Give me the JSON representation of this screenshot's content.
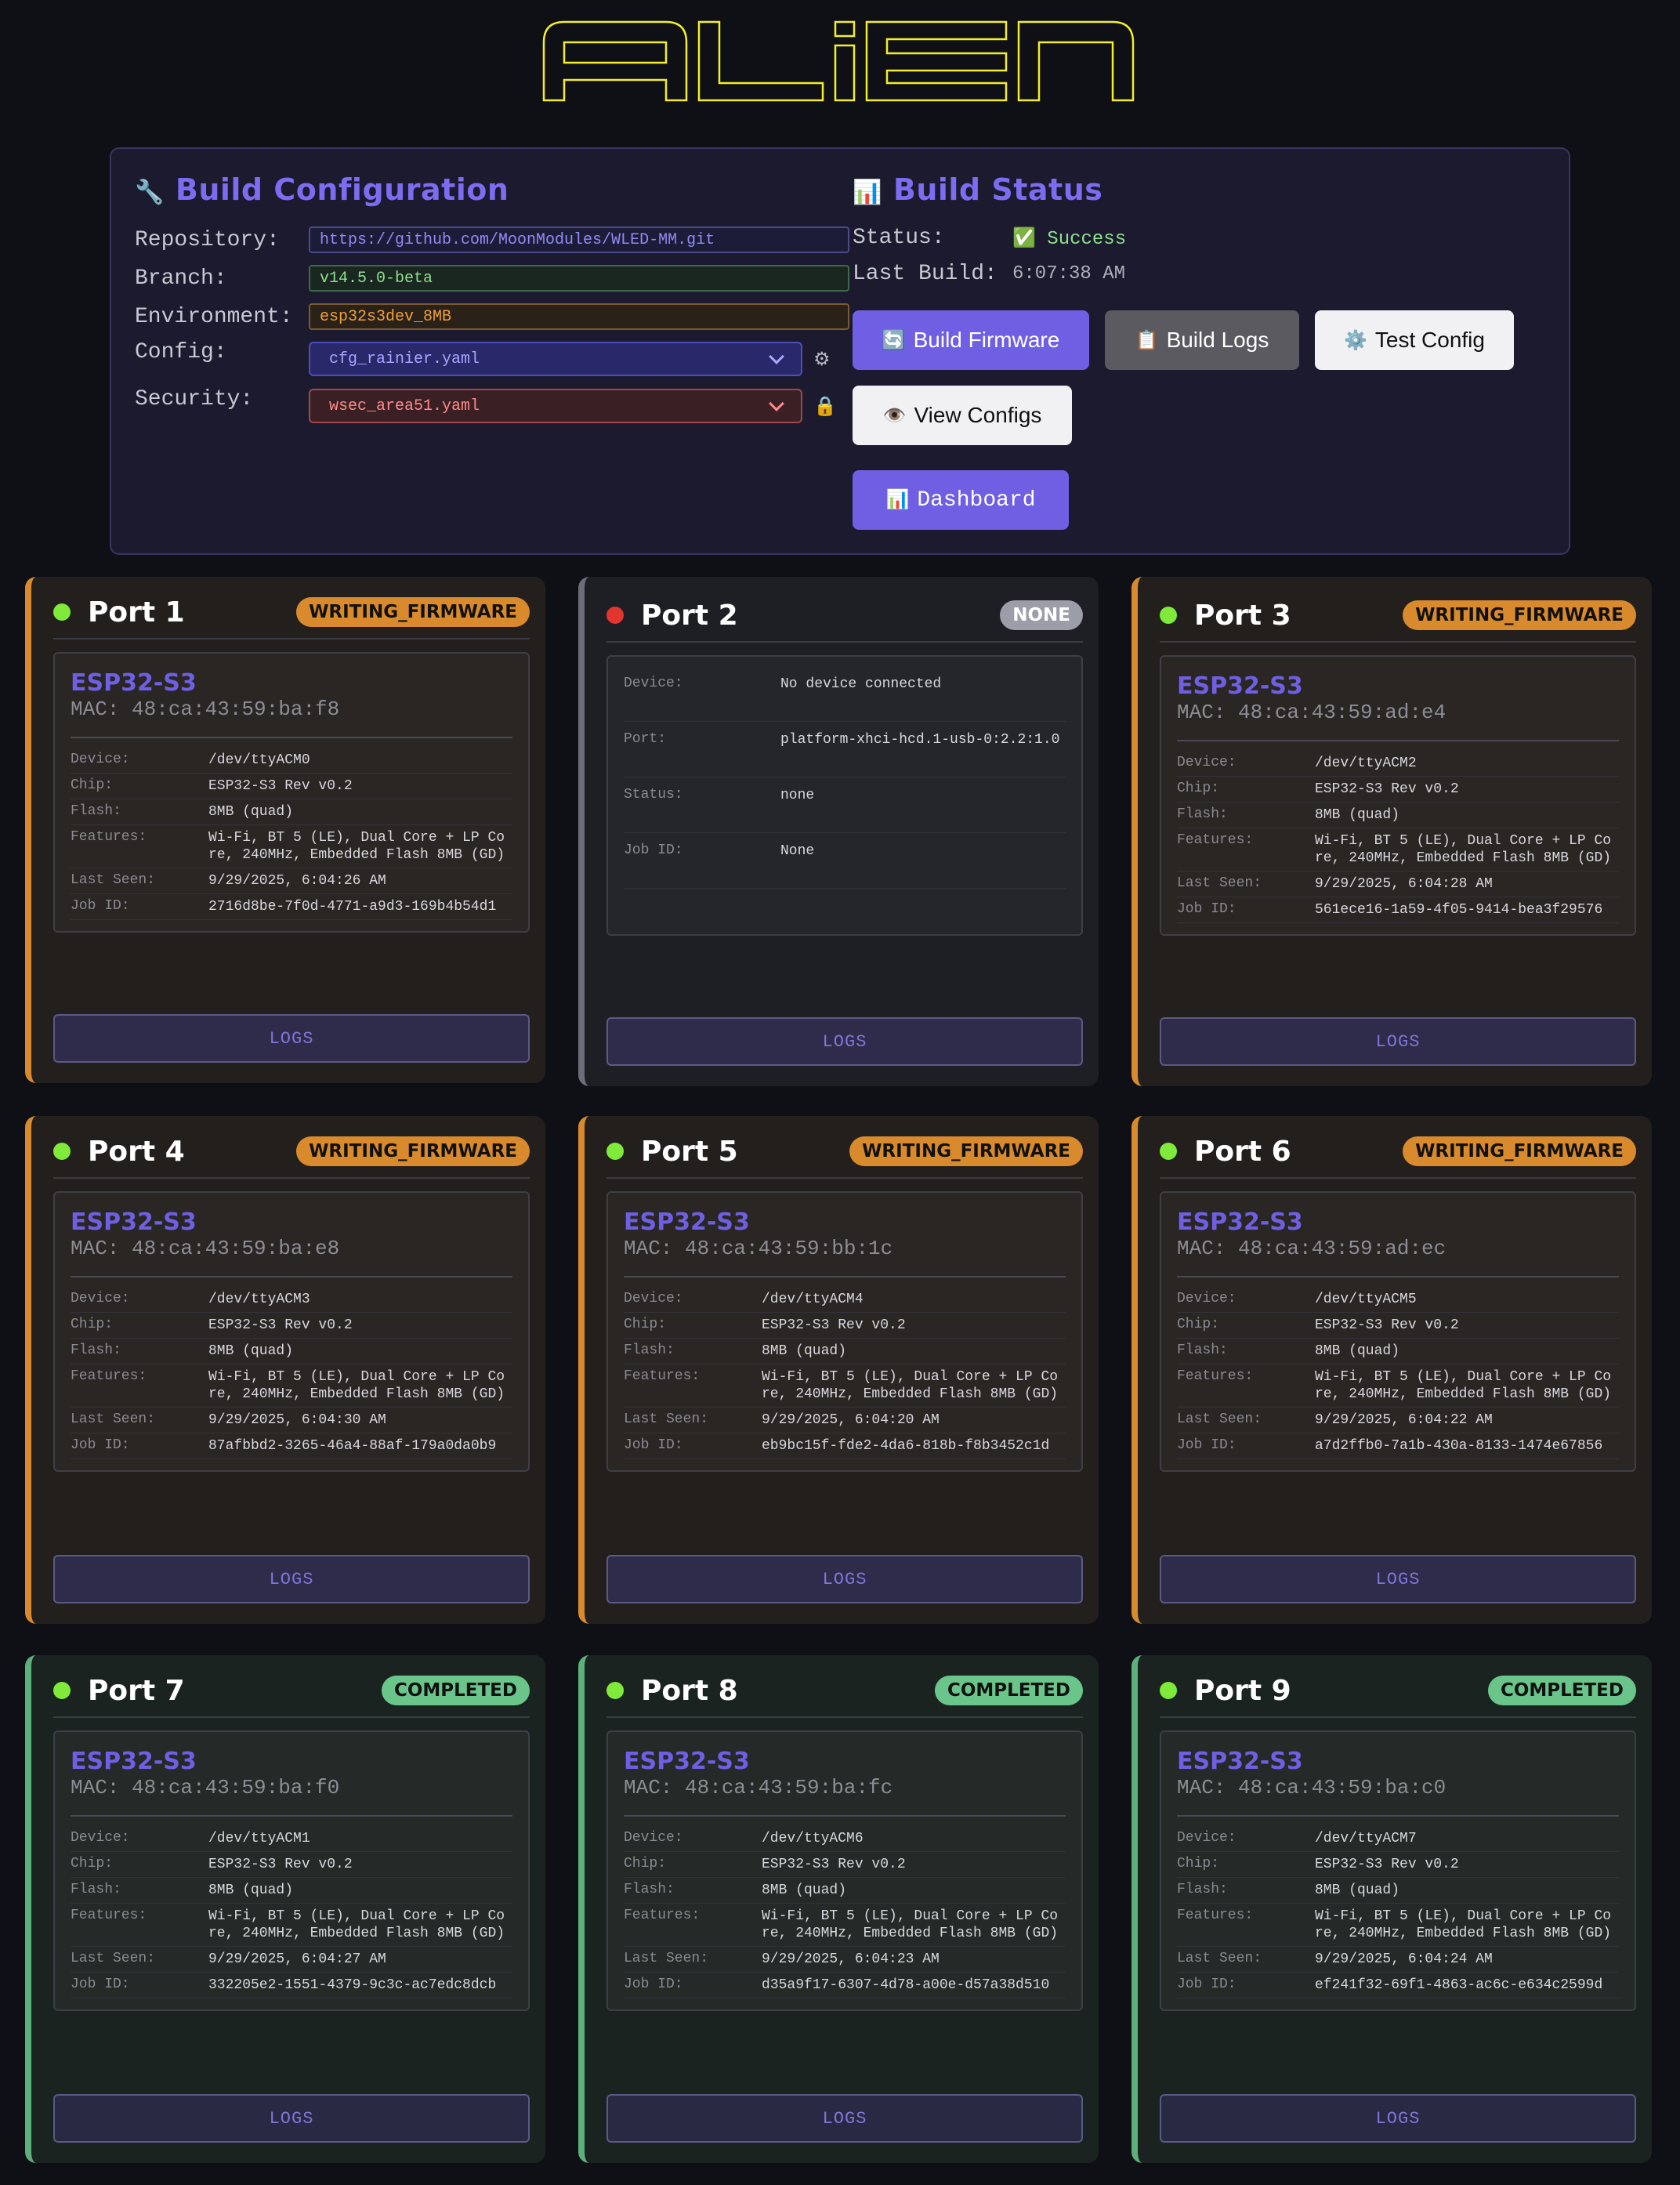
{
  "logo": {
    "text": "ALiEN"
  },
  "build_config": {
    "title": "Build Configuration",
    "icon": "wrench-icon",
    "repository_label": "Repository:",
    "repository": "https://github.com/MoonModules/WLED-MM.git",
    "branch_label": "Branch:",
    "branch": "v14.5.0-beta",
    "environment_label": "Environment:",
    "environment": "esp32s3dev_8MB",
    "config_label": "Config:",
    "config": "cfg_rainier.yaml",
    "security_label": "Security:",
    "security": "wsec_area51.yaml"
  },
  "build_status": {
    "title": "Build Status",
    "icon": "chart-icon",
    "status_label": "Status:",
    "status": "✅ Success",
    "last_build_label": "Last Build:",
    "last_build": "6:07:38 AM"
  },
  "buttons": {
    "build_firmware": "Build Firmware",
    "build_logs": "Build Logs",
    "test_config": "Test Config",
    "view_configs": "View Configs",
    "dashboard": "Dashboard"
  },
  "colors": {
    "accent": "#6f5fe3",
    "writing": "#d88a2d",
    "completed": "#6ac58a",
    "none": "#9b9ea8",
    "online": "#7fea3a",
    "offline": "#e3352f"
  },
  "labels": {
    "device": "Device:",
    "chip": "Chip:",
    "flash": "Flash:",
    "features": "Features:",
    "last_seen": "Last Seen:",
    "job_id": "Job ID:",
    "port": "Port:",
    "status": "Status:",
    "logs": "LOGS"
  },
  "ports": [
    {
      "name": "Port 1",
      "state": "WRITING_FIRMWARE",
      "chip_name": "ESP32-S3",
      "mac": "MAC: 48:ca:43:59:ba:f8",
      "device": "/dev/ttyACM0",
      "chip": "ESP32-S3 Rev v0.2",
      "flash": "8MB (quad)",
      "features": "Wi-Fi, BT 5 (LE), Dual Core + LP Core, 240MHz, Embedded Flash 8MB (GD)",
      "last_seen": "9/29/2025, 6:04:26 AM",
      "job_id": "2716d8be-7f0d-4771-a9d3-169b4b54d1"
    },
    {
      "name": "Port 2",
      "state": "NONE",
      "device": "No device connected",
      "port": "platform-xhci-hcd.1-usb-0:2.2:1.0",
      "status": "none",
      "job_id": "None"
    },
    {
      "name": "Port 3",
      "state": "WRITING_FIRMWARE",
      "chip_name": "ESP32-S3",
      "mac": "MAC: 48:ca:43:59:ad:e4",
      "device": "/dev/ttyACM2",
      "chip": "ESP32-S3 Rev v0.2",
      "flash": "8MB (quad)",
      "features": "Wi-Fi, BT 5 (LE), Dual Core + LP Core, 240MHz, Embedded Flash 8MB (GD)",
      "last_seen": "9/29/2025, 6:04:28 AM",
      "job_id": "561ece16-1a59-4f05-9414-bea3f29576"
    },
    {
      "name": "Port 4",
      "state": "WRITING_FIRMWARE",
      "chip_name": "ESP32-S3",
      "mac": "MAC: 48:ca:43:59:ba:e8",
      "device": "/dev/ttyACM3",
      "chip": "ESP32-S3 Rev v0.2",
      "flash": "8MB (quad)",
      "features": "Wi-Fi, BT 5 (LE), Dual Core + LP Core, 240MHz, Embedded Flash 8MB (GD)",
      "last_seen": "9/29/2025, 6:04:30 AM",
      "job_id": "87afbbd2-3265-46a4-88af-179a0da0b9"
    },
    {
      "name": "Port 5",
      "state": "WRITING_FIRMWARE",
      "chip_name": "ESP32-S3",
      "mac": "MAC: 48:ca:43:59:bb:1c",
      "device": "/dev/ttyACM4",
      "chip": "ESP32-S3 Rev v0.2",
      "flash": "8MB (quad)",
      "features": "Wi-Fi, BT 5 (LE), Dual Core + LP Core, 240MHz, Embedded Flash 8MB (GD)",
      "last_seen": "9/29/2025, 6:04:20 AM",
      "job_id": "eb9bc15f-fde2-4da6-818b-f8b3452c1d"
    },
    {
      "name": "Port 6",
      "state": "WRITING_FIRMWARE",
      "chip_name": "ESP32-S3",
      "mac": "MAC: 48:ca:43:59:ad:ec",
      "device": "/dev/ttyACM5",
      "chip": "ESP32-S3 Rev v0.2",
      "flash": "8MB (quad)",
      "features": "Wi-Fi, BT 5 (LE), Dual Core + LP Core, 240MHz, Embedded Flash 8MB (GD)",
      "last_seen": "9/29/2025, 6:04:22 AM",
      "job_id": "a7d2ffb0-7a1b-430a-8133-1474e67856"
    },
    {
      "name": "Port 7",
      "state": "COMPLETED",
      "chip_name": "ESP32-S3",
      "mac": "MAC: 48:ca:43:59:ba:f0",
      "device": "/dev/ttyACM1",
      "chip": "ESP32-S3 Rev v0.2",
      "flash": "8MB (quad)",
      "features": "Wi-Fi, BT 5 (LE), Dual Core + LP Core, 240MHz, Embedded Flash 8MB (GD)",
      "last_seen": "9/29/2025, 6:04:27 AM",
      "job_id": "332205e2-1551-4379-9c3c-ac7edc8dcb"
    },
    {
      "name": "Port 8",
      "state": "COMPLETED",
      "chip_name": "ESP32-S3",
      "mac": "MAC: 48:ca:43:59:ba:fc",
      "device": "/dev/ttyACM6",
      "chip": "ESP32-S3 Rev v0.2",
      "flash": "8MB (quad)",
      "features": "Wi-Fi, BT 5 (LE), Dual Core + LP Core, 240MHz, Embedded Flash 8MB (GD)",
      "last_seen": "9/29/2025, 6:04:23 AM",
      "job_id": "d35a9f17-6307-4d78-a00e-d57a38d510"
    },
    {
      "name": "Port 9",
      "state": "COMPLETED",
      "chip_name": "ESP32-S3",
      "mac": "MAC: 48:ca:43:59:ba:c0",
      "device": "/dev/ttyACM7",
      "chip": "ESP32-S3 Rev v0.2",
      "flash": "8MB (quad)",
      "features": "Wi-Fi, BT 5 (LE), Dual Core + LP Core, 240MHz, Embedded Flash 8MB (GD)",
      "last_seen": "9/29/2025, 6:04:24 AM",
      "job_id": "ef241f32-69f1-4863-ac6c-e634c2599d"
    }
  ]
}
